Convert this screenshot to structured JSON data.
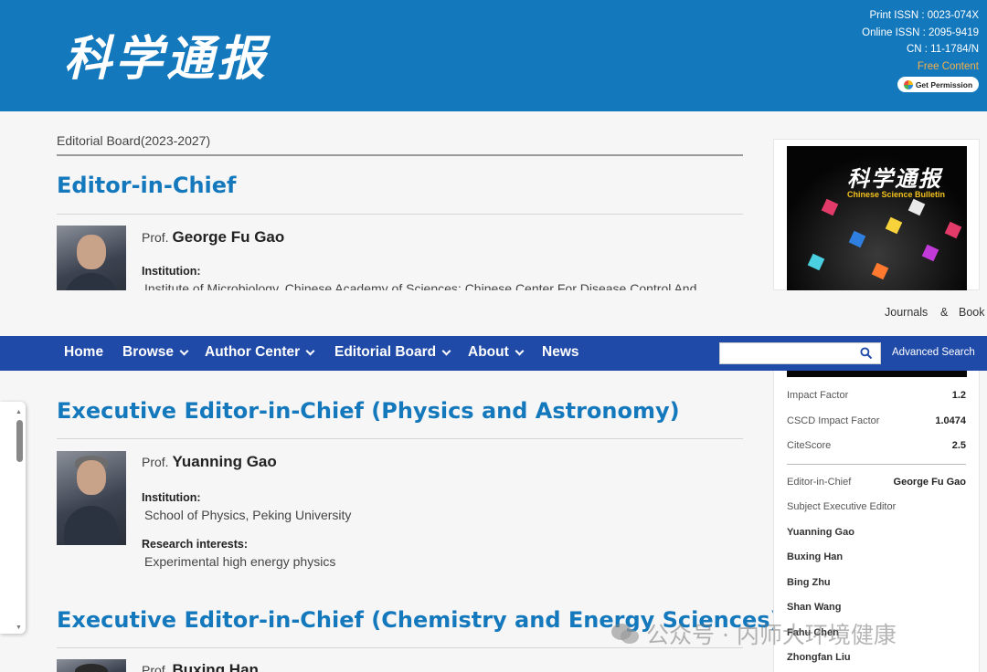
{
  "header": {
    "logo_text": "科学通报",
    "print_issn": "Print ISSN : 0023-074X",
    "online_issn": "Online ISSN : 2095-9419",
    "cn": "CN : 11-1784/N",
    "free_content": "Free Content",
    "permission_button": "Get Permission"
  },
  "breadcrumb": "Editorial Board(2023-2027)",
  "sections": {
    "chief": {
      "title": "Editor-in-Chief",
      "prefix": "Prof.",
      "name": "George Fu Gao",
      "institution_label": "Institution:",
      "institution": "Institute of Microbiology, Chinese Academy of Sciences; Chinese Center For Disease Control And"
    },
    "physics": {
      "title": "Executive Editor-in-Chief (Physics and Astronomy)",
      "prefix": "Prof.",
      "name": "Yuanning Gao",
      "institution_label": "Institution:",
      "institution": "School of Physics, Peking University",
      "research_label": "Research interests:",
      "research": "Experimental high energy physics"
    },
    "chemistry": {
      "title": "Executive Editor-in-Chief (Chemistry and Energy Sciences)",
      "prefix": "Prof.",
      "name": "Buxing Han"
    }
  },
  "cover": {
    "title": "科学通报",
    "subtitle": "Chinese Science Bulletin"
  },
  "top_links": {
    "journals": "Journals",
    "amp": "&",
    "books": "Book"
  },
  "nav": {
    "home": "Home",
    "browse": "Browse",
    "author_center": "Author Center",
    "editorial_board": "Editorial Board",
    "about": "About",
    "news": "News",
    "search_value": "",
    "advanced_search": "Advanced Search"
  },
  "metrics": [
    {
      "label": "Impact Factor",
      "value": "1.2"
    },
    {
      "label": "CSCD Impact Factor",
      "value": "1.0474"
    },
    {
      "label": "CiteScore",
      "value": "2.5"
    }
  ],
  "editors": {
    "chief_label": "Editor-in-Chief",
    "chief_name": "George Fu Gao",
    "subject_label": "Subject Executive Editor",
    "names": [
      "Yuanning Gao",
      "Buxing Han",
      "Bing Zhu",
      "Shan Wang",
      "Fahu Chen",
      "Zhongfan Liu"
    ]
  },
  "watermark": "公众号 · 内师大环境健康"
}
